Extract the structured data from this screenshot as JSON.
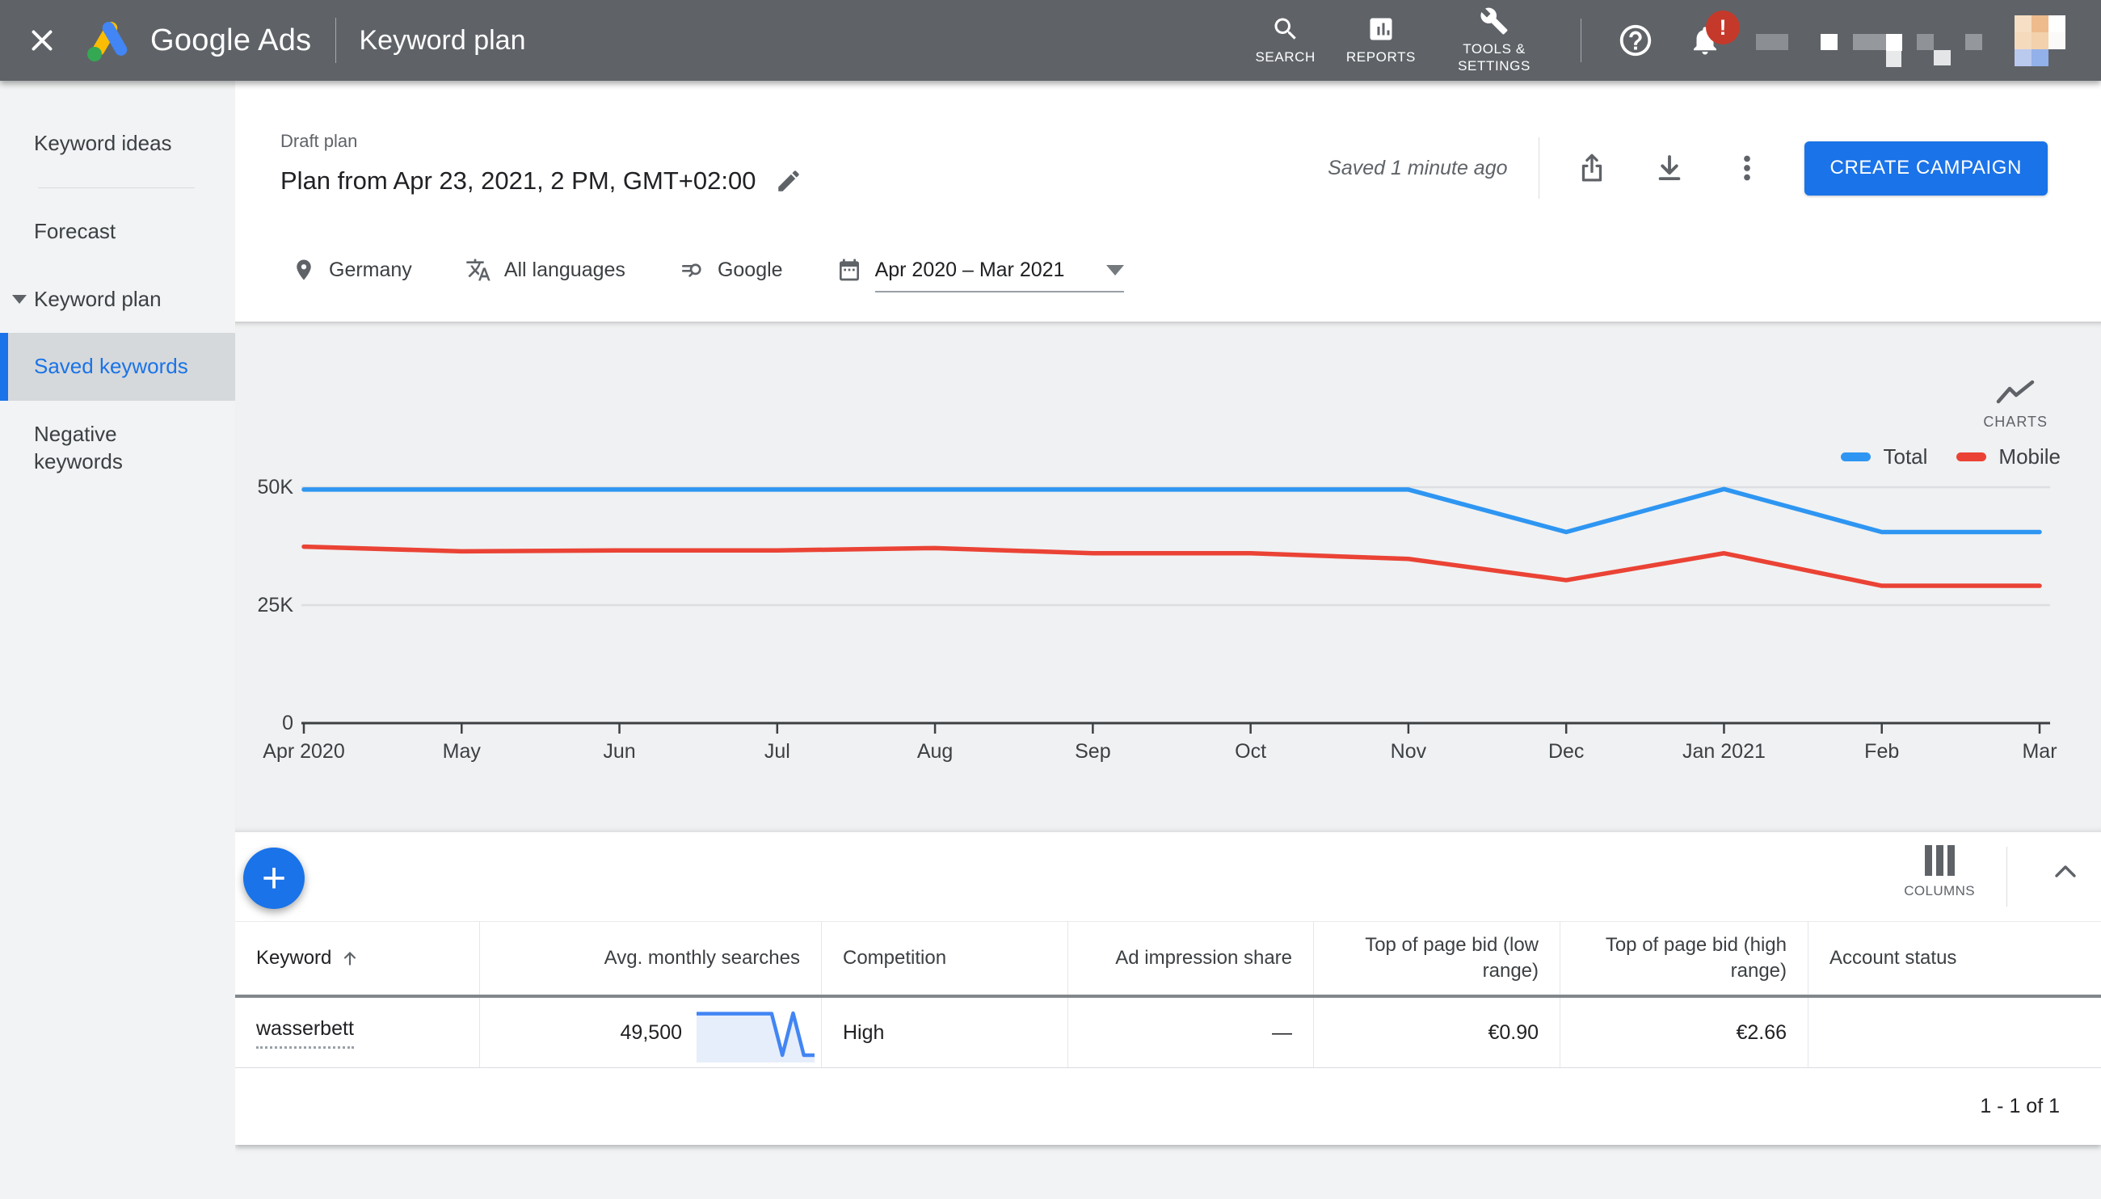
{
  "topbar": {
    "brand": "Google Ads",
    "page_title": "Keyword plan",
    "nav": [
      {
        "label": "SEARCH"
      },
      {
        "label": "REPORTS"
      },
      {
        "label": "TOOLS & SETTINGS"
      }
    ],
    "notification_badge": "!"
  },
  "sidebar": {
    "items": [
      {
        "label": "Keyword ideas"
      },
      {
        "label": "Forecast"
      },
      {
        "label": "Keyword plan",
        "expanded": true
      },
      {
        "label": "Saved keywords",
        "selected": true
      },
      {
        "label": "Negative keywords"
      }
    ]
  },
  "plan_header": {
    "kicker": "Draft plan",
    "title": "Plan from Apr 23, 2021, 2 PM, GMT+02:00",
    "saved_status": "Saved 1 minute ago",
    "create_campaign_label": "CREATE CAMPAIGN"
  },
  "filters": {
    "location": "Germany",
    "language": "All languages",
    "network": "Google",
    "date_range": "Apr 2020 – Mar 2021"
  },
  "chart_widget_label": "CHARTS",
  "chart_data": {
    "type": "line",
    "x": [
      "Apr 2020",
      "May",
      "Jun",
      "Jul",
      "Aug",
      "Sep",
      "Oct",
      "Nov",
      "Dec",
      "Jan 2021",
      "Feb",
      "Mar"
    ],
    "series": [
      {
        "name": "Total",
        "color": "#2e96f2",
        "values": [
          49500,
          49500,
          49500,
          49500,
          49500,
          49500,
          49500,
          49500,
          40500,
          49600,
          40500,
          40500
        ]
      },
      {
        "name": "Mobile",
        "color": "#ea4335",
        "values": [
          37400,
          36400,
          36600,
          36600,
          37100,
          36000,
          36000,
          34800,
          30300,
          36000,
          29100,
          29100
        ]
      }
    ],
    "ylim": [
      0,
      50000
    ],
    "yticks": [
      {
        "value": 0,
        "label": "0"
      },
      {
        "value": 25000,
        "label": "25K"
      },
      {
        "value": 50000,
        "label": "50K"
      }
    ],
    "legend_position": "top-right",
    "grid": "horizontal"
  },
  "table": {
    "columns_button": "COLUMNS",
    "columns": [
      {
        "label": "Keyword",
        "sorted": "asc"
      },
      {
        "label": "Avg. monthly searches"
      },
      {
        "label": "Competition"
      },
      {
        "label": "Ad impression share"
      },
      {
        "label": "Top of page bid (low range)"
      },
      {
        "label": "Top of page bid (high range)"
      },
      {
        "label": "Account status"
      }
    ],
    "row": {
      "keyword": "wasserbett",
      "avg_monthly_searches": "49,500",
      "competition": "High",
      "ad_impression_share": "—",
      "top_of_page_bid_low": "€0.90",
      "top_of_page_bid_high": "€2.66",
      "account_status": ""
    },
    "pagination": "1 - 1 of 1"
  },
  "colors": {
    "topbar_bg": "#5f6368",
    "accent_blue": "#1a73e8",
    "chart_total": "#2e96f2",
    "chart_mobile": "#ea4335",
    "sparkline": "#4285f4",
    "badge_red": "#c5392b"
  }
}
